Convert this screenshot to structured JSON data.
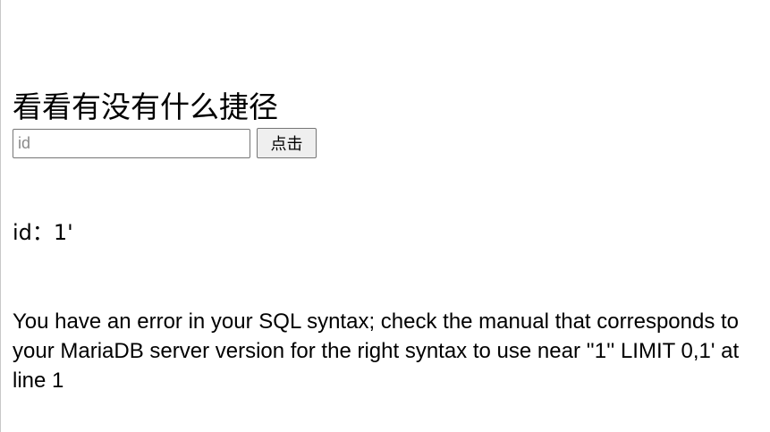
{
  "page": {
    "title": "看看有没有什么捷径"
  },
  "form": {
    "input_value": "",
    "input_placeholder": "id",
    "submit_label": "点击"
  },
  "result": {
    "id_label": "id：",
    "id_value": "1'",
    "error_text": "You have an error in your SQL syntax; check the manual that corresponds to your MariaDB server version for the right syntax to use near ''1'' LIMIT 0,1' at line 1"
  }
}
